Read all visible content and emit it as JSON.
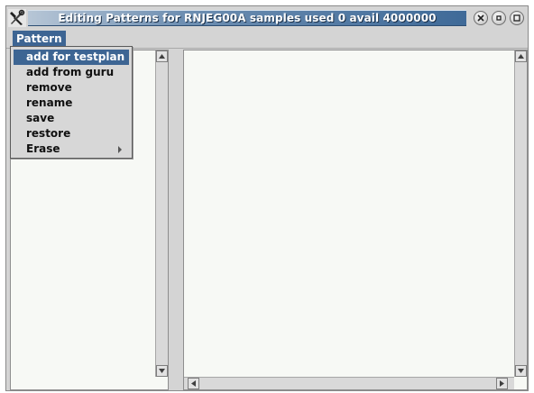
{
  "window": {
    "title": "Editing Patterns for RNJEG00A samples used 0 avail 4000000"
  },
  "menubar": {
    "pattern_label": "Pattern"
  },
  "pattern_menu": {
    "items": [
      {
        "label": "add for testplan",
        "selected": true,
        "has_submenu": false
      },
      {
        "label": "add from guru",
        "selected": false,
        "has_submenu": false
      },
      {
        "label": "remove",
        "selected": false,
        "has_submenu": false
      },
      {
        "label": "rename",
        "selected": false,
        "has_submenu": false
      },
      {
        "label": "save",
        "selected": false,
        "has_submenu": false
      },
      {
        "label": "restore",
        "selected": false,
        "has_submenu": false
      },
      {
        "label": "Erase",
        "selected": false,
        "has_submenu": true
      }
    ]
  },
  "icons": {
    "app": "tools-icon",
    "close": "close-icon",
    "minimize": "minimize-icon",
    "maximize": "maximize-icon"
  },
  "colors": {
    "selection": "#3d6593",
    "pane_background": "#f7f9f5",
    "chrome": "#d4d4d4"
  }
}
